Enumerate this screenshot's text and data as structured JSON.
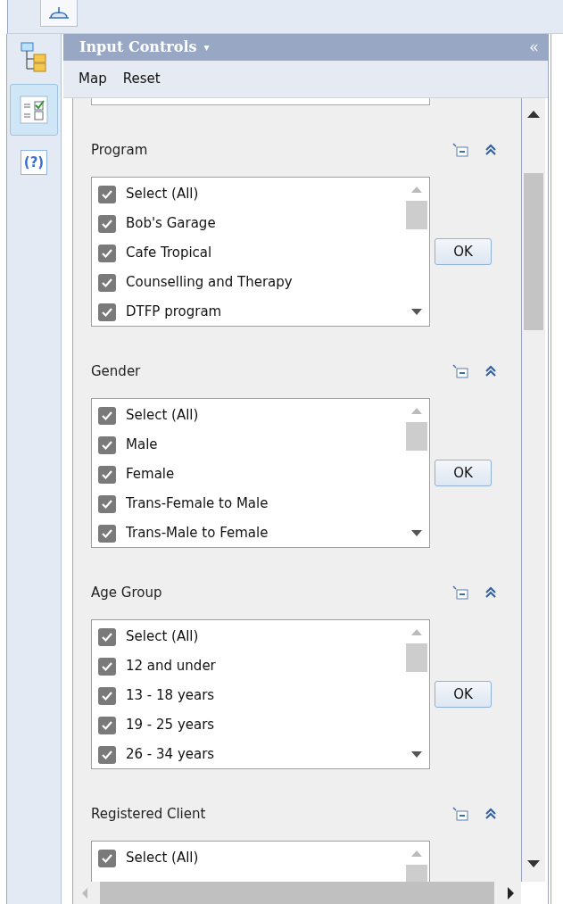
{
  "panel": {
    "title": "Input Controls",
    "title_caret": "▾",
    "collapse": "«"
  },
  "rail": {
    "items": [
      {
        "kind": "tree",
        "selected": false
      },
      {
        "kind": "controls",
        "selected": true
      },
      {
        "kind": "help",
        "label": "(?)",
        "selected": false
      }
    ]
  },
  "toolbar": [
    "Map",
    "Reset"
  ],
  "sections": [
    {
      "title": "Program",
      "ok": "OK",
      "items": [
        {
          "label": "Select (All)",
          "checked": true
        },
        {
          "label": "Bob's Garage",
          "checked": true
        },
        {
          "label": "Cafe Tropical",
          "checked": true
        },
        {
          "label": "Counselling and Therapy",
          "checked": true
        },
        {
          "label": "DTFP program",
          "checked": true
        }
      ]
    },
    {
      "title": "Gender",
      "ok": "OK",
      "items": [
        {
          "label": "Select (All)",
          "checked": true
        },
        {
          "label": "Male",
          "checked": true
        },
        {
          "label": "Female",
          "checked": true
        },
        {
          "label": "Trans-Female to Male",
          "checked": true
        },
        {
          "label": "Trans-Male to Female",
          "checked": true
        }
      ]
    },
    {
      "title": "Age Group",
      "ok": "OK",
      "items": [
        {
          "label": "Select (All)",
          "checked": true
        },
        {
          "label": "12 and under",
          "checked": true
        },
        {
          "label": "13 - 18 years",
          "checked": true
        },
        {
          "label": "19 - 25 years",
          "checked": true
        },
        {
          "label": "26 - 34 years",
          "checked": true
        }
      ]
    },
    {
      "title": "Registered Client",
      "items": [
        {
          "label": "Select (All)",
          "checked": true
        }
      ]
    }
  ]
}
